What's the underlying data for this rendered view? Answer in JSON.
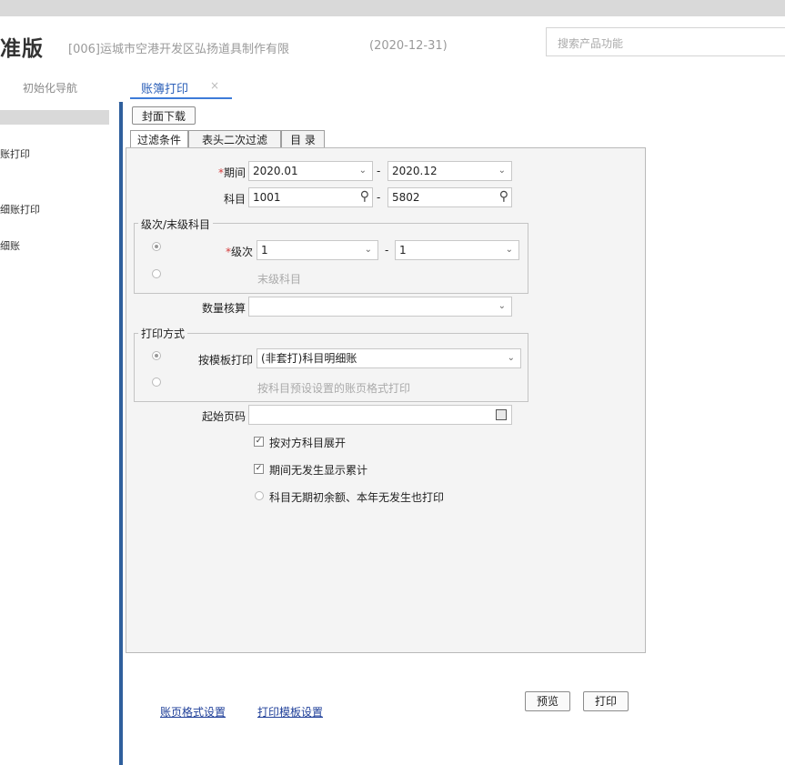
{
  "header": {
    "brand": "准版",
    "company": "[006]运城市空港开发区弘扬道具制作有限",
    "date": "(2020-12-31)",
    "search_placeholder": "搜索产品功能"
  },
  "tabs": [
    {
      "label": "初始化导航"
    },
    {
      "label": "账簿打印",
      "close": "×",
      "active": true
    }
  ],
  "sidebar": {
    "items": [
      {
        "label": "账打印"
      },
      {
        "label": "细账打印"
      },
      {
        "label": "细账"
      }
    ]
  },
  "toolbar": {
    "cover_download": "封面下载"
  },
  "filter_tabs": [
    "过滤条件",
    "表头二次过滤",
    "目 录"
  ],
  "form": {
    "period": {
      "label": "期间",
      "required": "*",
      "from": "2020.01",
      "to": "2020.12"
    },
    "subject": {
      "label": "科目",
      "from": "1001",
      "to": "5802"
    },
    "dash": "-",
    "level_group": {
      "title": "级次/末级科目",
      "level": {
        "label": "级次",
        "required": "*",
        "from": "1",
        "to": "1"
      },
      "last_level_option": "末级科目"
    },
    "quantity": {
      "label": "数量核算",
      "value": ""
    },
    "print_group": {
      "title": "打印方式",
      "template": {
        "label": "按模板打印",
        "value": "(非套打)科目明细账"
      },
      "format_option": "按科目预设设置的账页格式打印"
    },
    "start_page": {
      "label": "起始页码",
      "value": ""
    },
    "options": [
      {
        "label": "按对方科目展开",
        "checked": true
      },
      {
        "label": "期间无发生显示累计",
        "checked": true
      },
      {
        "label": "科目无期初余额、本年无发生也打印",
        "checked": false
      }
    ]
  },
  "footer": {
    "link_format": "账页格式设置",
    "link_template": "打印模板设置",
    "preview_button": "预览",
    "print_button": "打印"
  },
  "icons": {
    "dropdown": "chevron-down-icon",
    "lookup": "search-icon",
    "calendar": "calculator-icon",
    "check": "checkmark-icon"
  },
  "colors": {
    "accent": "#2b5fb8",
    "sidebar_divider": "#2f5f9d",
    "panel_bg": "#f4f4f4",
    "required": "#d43c3c"
  }
}
